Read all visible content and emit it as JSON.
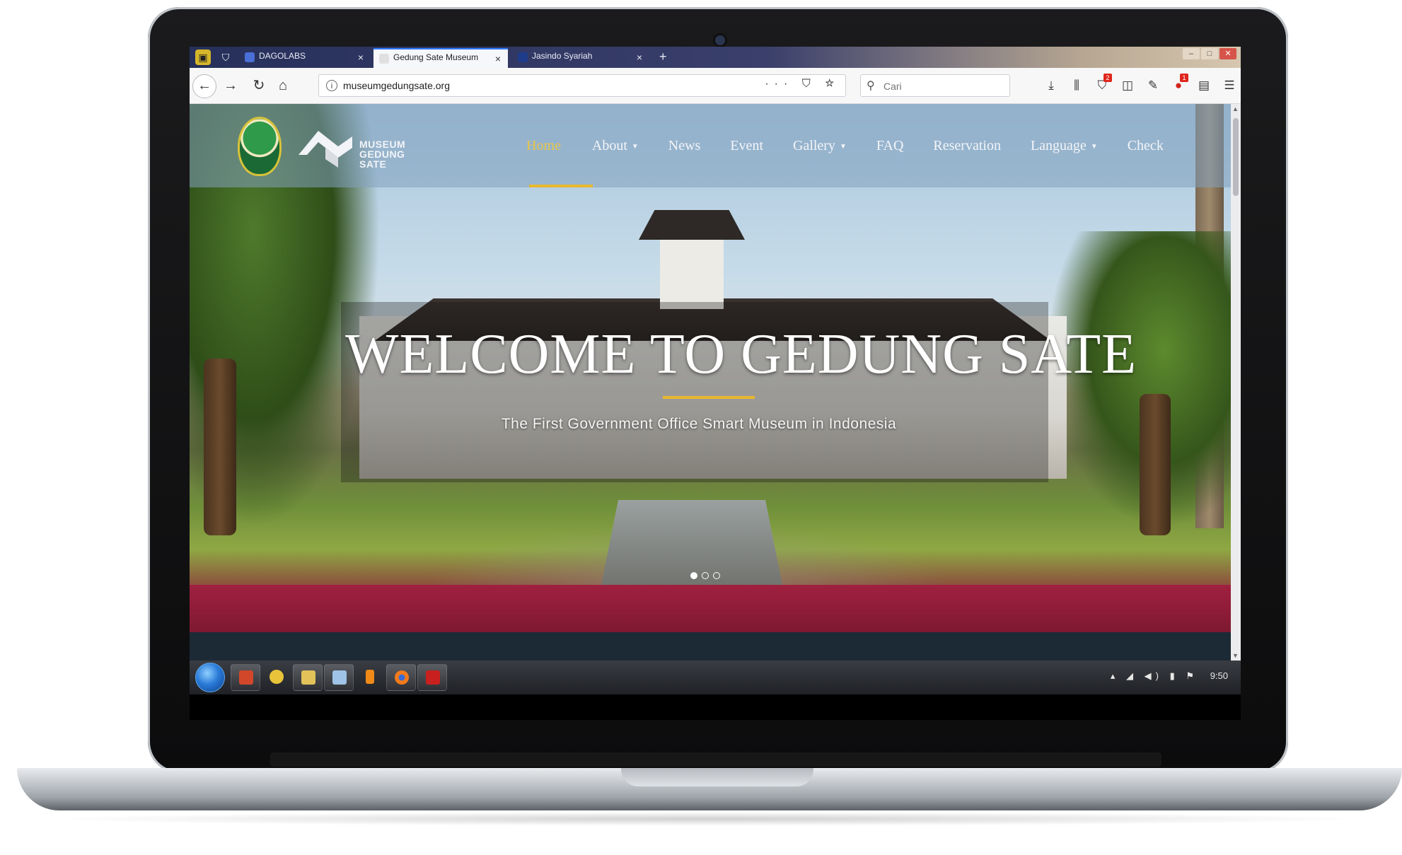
{
  "browser": {
    "tabs": [
      {
        "label": "DAGOLABS",
        "active": false
      },
      {
        "label": "Gedung Sate Museum",
        "active": true
      },
      {
        "label": "Jasindo Syariah",
        "active": false
      }
    ],
    "tab_close": "×",
    "new_tab": "+",
    "url": "museumgedungsate.org",
    "url_actions": "··· ⛉ ☆",
    "search_placeholder": "Cari",
    "badges": {
      "pocket": "2",
      "notifications": "1"
    }
  },
  "site": {
    "logo_text": [
      "MUSEUM",
      "GEDUNG",
      "SATE"
    ],
    "menu": [
      {
        "label": "Home",
        "active": true,
        "dropdown": false
      },
      {
        "label": "About",
        "active": false,
        "dropdown": true
      },
      {
        "label": "News",
        "active": false,
        "dropdown": false
      },
      {
        "label": "Event",
        "active": false,
        "dropdown": false
      },
      {
        "label": "Gallery",
        "active": false,
        "dropdown": true
      },
      {
        "label": "FAQ",
        "active": false,
        "dropdown": false
      },
      {
        "label": "Reservation",
        "active": false,
        "dropdown": false
      },
      {
        "label": "Language",
        "active": false,
        "dropdown": true
      },
      {
        "label": "Check",
        "active": false,
        "dropdown": false
      }
    ],
    "hero_title": "WELCOME TO GEDUNG SATE",
    "hero_subtitle": "The First Government Office Smart Museum in Indonesia",
    "slides": {
      "count": 3,
      "current": 1
    },
    "accent_color": "#e7b82f"
  },
  "taskbar": {
    "clock": "9:50",
    "apps": [
      "powerpoint-icon",
      "paint-icon",
      "explorer-icon",
      "notepad-icon",
      "sublime-icon",
      "firefox-icon",
      "acrobat-icon"
    ]
  }
}
